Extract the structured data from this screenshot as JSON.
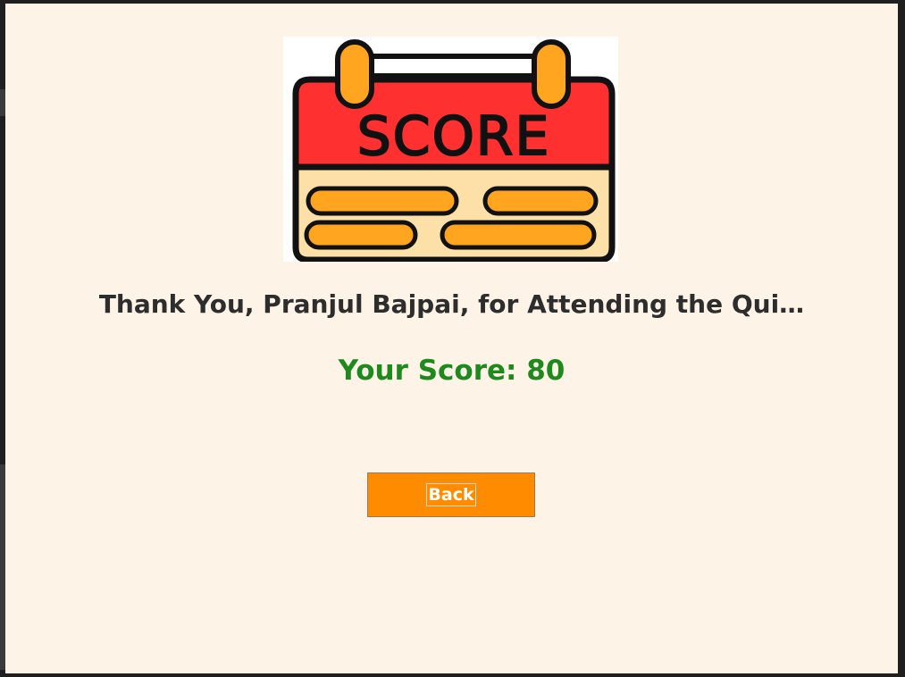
{
  "logo": {
    "text": "SCORE",
    "icon": "score-board-icon"
  },
  "heading": {
    "text": "Thank You, Pranjul Bajpai, for Attending the Qui…"
  },
  "score": {
    "text": "Your Score: 80"
  },
  "back_button": {
    "label": "Back"
  },
  "colors": {
    "background": "#fdf3e6",
    "score_text": "#1e8a1e",
    "button": "#ff8c00",
    "logo_red": "#ff3030",
    "logo_orange": "#ffa51f",
    "logo_cream": "#fde0a8"
  }
}
